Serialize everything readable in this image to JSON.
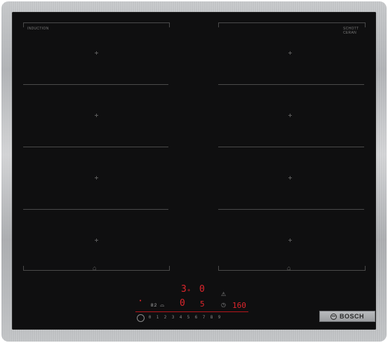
{
  "cooktop": {
    "brand_name": "BOSCH",
    "left_label": "INDUCTION",
    "left_sublabel": "",
    "right_label": "SCHOTT",
    "right_sublabel": "CERAN",
    "right_tiny": ""
  },
  "display": {
    "zone_top_left": "3",
    "zone_top_left_suffix": "+",
    "zone_top_right": "0",
    "zone_bottom_left": "0",
    "zone_bottom_mid": "5",
    "timer_value": "160",
    "timer_mode": "8:2",
    "scale_digits": [
      "0",
      "1",
      "2",
      "3",
      "4",
      "5",
      "6",
      "7",
      "8",
      "9"
    ]
  },
  "colors": {
    "glass": "#0f0f10",
    "frame": "#c0c2c4",
    "display_red": "#e0262c",
    "zone_line": "#4a4a4a"
  },
  "icons": [
    "power-icon",
    "cross-marker-icon",
    "bridge-icon",
    "timer-icon",
    "lock-icon",
    "brand-logo-icon"
  ]
}
